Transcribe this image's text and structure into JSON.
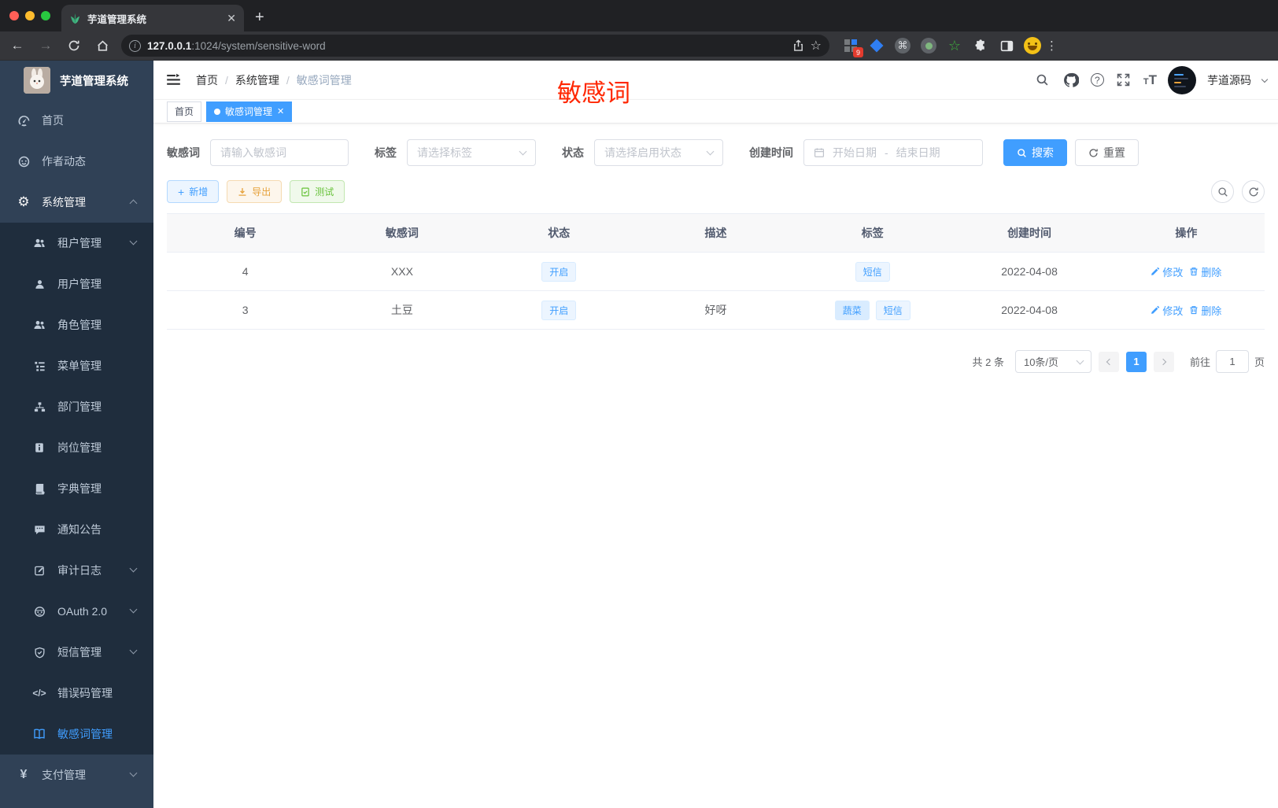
{
  "browser": {
    "tab_title": "芋道管理系统",
    "url_host": "127.0.0.1",
    "url_rest": ":1024/system/sensitive-word",
    "extension_badge": "9"
  },
  "header": {
    "logo_title": "芋道管理系统",
    "breadcrumb": {
      "home": "首页",
      "section": "系统管理",
      "current": "敏感词管理"
    },
    "user_name": "芋道源码",
    "annotation": "敏感词"
  },
  "tags_view": {
    "home_tab": "首页",
    "active_tab": "敏感词管理"
  },
  "sidebar": {
    "items": [
      {
        "label": "首页",
        "icon": "gauge-icon"
      },
      {
        "label": "作者动态",
        "icon": "author-chat-icon"
      },
      {
        "label": "系统管理",
        "icon": "gear-icon",
        "expanded": true
      },
      {
        "label": "租户管理",
        "icon": "users-icon"
      },
      {
        "label": "用户管理",
        "icon": "user-icon"
      },
      {
        "label": "角色管理",
        "icon": "roles-icon"
      },
      {
        "label": "菜单管理",
        "icon": "menu-tree-icon"
      },
      {
        "label": "部门管理",
        "icon": "org-tree-icon"
      },
      {
        "label": "岗位管理",
        "icon": "post-badge-icon"
      },
      {
        "label": "字典管理",
        "icon": "dict-book-icon"
      },
      {
        "label": "通知公告",
        "icon": "notice-icon"
      },
      {
        "label": "审计日志",
        "icon": "audit-log-icon"
      },
      {
        "label": "OAuth 2.0",
        "icon": "oauth-robot-icon"
      },
      {
        "label": "短信管理",
        "icon": "shield-icon"
      },
      {
        "label": "错误码管理",
        "icon": "code-icon"
      },
      {
        "label": "敏感词管理",
        "icon": "open-book-icon",
        "active": true
      },
      {
        "label": "支付管理",
        "icon": "yen-icon"
      }
    ]
  },
  "filters": {
    "keyword_label": "敏感词",
    "keyword_placeholder": "请输入敏感词",
    "tag_label": "标签",
    "tag_placeholder": "请选择标签",
    "status_label": "状态",
    "status_placeholder": "请选择启用状态",
    "date_label": "创建时间",
    "date_start_placeholder": "开始日期",
    "date_separator": "-",
    "date_end_placeholder": "结束日期",
    "search_label": "搜索",
    "reset_label": "重置"
  },
  "toolbar": {
    "add_label": "新增",
    "export_label": "导出",
    "test_label": "测试"
  },
  "table": {
    "headers": [
      "编号",
      "敏感词",
      "状态",
      "描述",
      "标签",
      "创建时间",
      "操作"
    ],
    "edit_label": "修改",
    "delete_label": "删除",
    "rows": [
      {
        "id": "4",
        "word": "XXX",
        "status": "开启",
        "desc": "",
        "tags": [
          "短信"
        ],
        "created": "2022-04-08"
      },
      {
        "id": "3",
        "word": "土豆",
        "status": "开启",
        "desc": "好呀",
        "tags": [
          "蔬菜",
          "短信"
        ],
        "created": "2022-04-08"
      }
    ]
  },
  "pagination": {
    "total": "共 2 条",
    "page_size": "10条/页",
    "current_page": "1",
    "goto_label": "前往",
    "goto_value": "1",
    "page_label": "页"
  },
  "colors": {
    "accent": "#409eff",
    "warning": "#e6a23c",
    "success": "#67c23a",
    "annotation_red": "#ff2600",
    "sidebar_bg": "#304156",
    "submenu_bg": "#1f2d3d"
  }
}
